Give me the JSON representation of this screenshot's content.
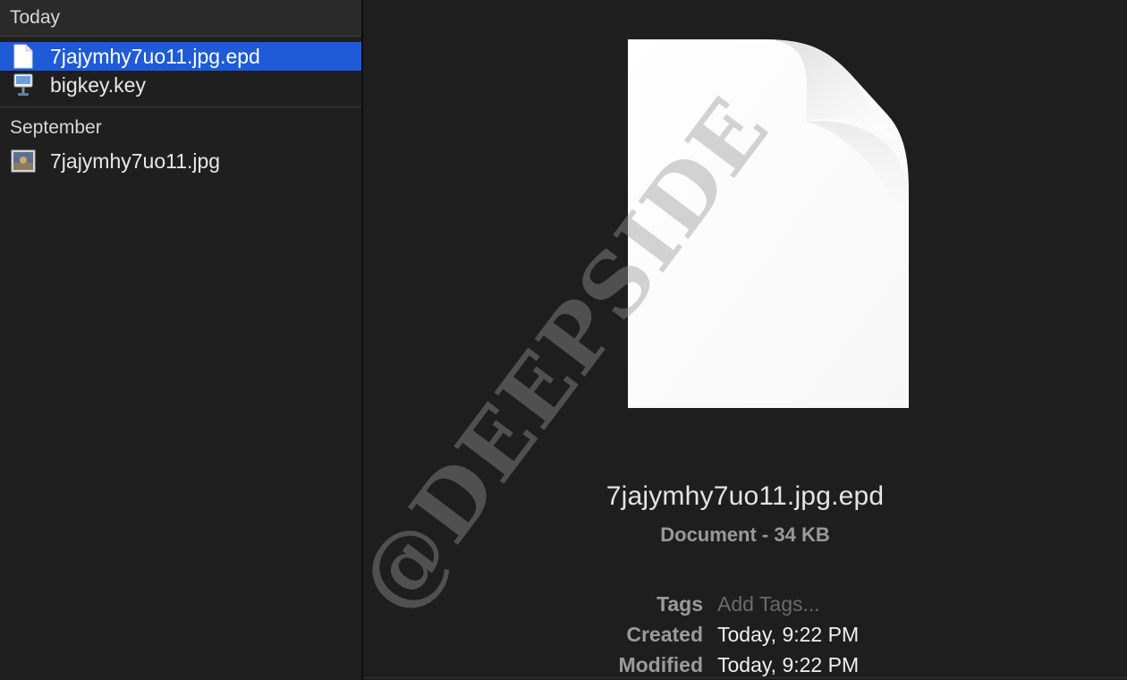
{
  "sidebar": {
    "sections": [
      {
        "header": "Today",
        "items": [
          {
            "label": "7jajymhy7uo11.jpg.epd",
            "icon": "blank-document-icon",
            "selected": true
          },
          {
            "label": "bigkey.key",
            "icon": "keynote-file-icon",
            "selected": false
          }
        ]
      },
      {
        "header": "September",
        "items": [
          {
            "label": "7jajymhy7uo11.jpg",
            "icon": "image-thumbnail-icon",
            "selected": false
          }
        ]
      }
    ]
  },
  "preview": {
    "icon": "generic-document-icon",
    "file_name": "7jajymhy7uo11.jpg.epd",
    "kind_size": "Document - 34 KB",
    "tags_label": "Tags",
    "tags_placeholder": "Add Tags...",
    "created_label": "Created",
    "created_value": "Today, 9:22 PM",
    "modified_label": "Modified",
    "modified_value": "Today, 9:22 PM"
  },
  "watermark": "@DEEPSIDE",
  "colors": {
    "selection": "#1f5bd6",
    "background": "#1e1e1e",
    "sidebar_header": "#2a2a2a"
  }
}
